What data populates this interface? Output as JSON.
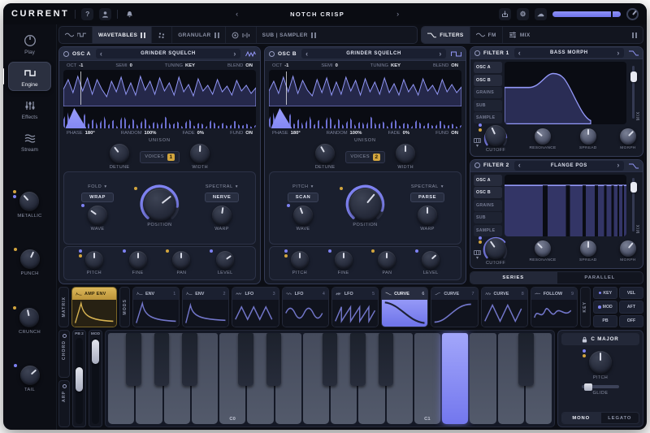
{
  "colors": {
    "accent": "#7b7ff0",
    "gold": "#d2a53e"
  },
  "icons": {
    "chevron_left": "‹",
    "chevron_right": "›",
    "help": "?",
    "gear": "⚙",
    "cloud": "☁",
    "dropdown": "▾"
  },
  "topbar": {
    "logo": "CURRENT",
    "preset": "NOTCH CRISP"
  },
  "sidebar": {
    "nav": [
      {
        "label": "Play"
      },
      {
        "label": "Engine"
      },
      {
        "label": "Effects"
      },
      {
        "label": "Stream"
      }
    ],
    "macros": [
      {
        "label": "METALLIC"
      },
      {
        "label": "PUNCH"
      },
      {
        "label": "CRUNCH"
      },
      {
        "label": "TAIL"
      }
    ]
  },
  "tabs": {
    "wavetables": "WAVETABLES",
    "granular": "GRANULAR",
    "sub_sampler": "SUB | SAMPLER",
    "filters": "FILTERS",
    "fm": "FM",
    "mix": "MIX"
  },
  "osc_a": {
    "title": "OSC A",
    "preset": "GRINDER SQUELCH",
    "top_params": [
      [
        "OCT",
        "-1"
      ],
      [
        "SEMI",
        "0"
      ],
      [
        "TUNING",
        "KEY"
      ],
      [
        "BLEND",
        "ON"
      ]
    ],
    "wave_params": [
      [
        "PHASE",
        "180°"
      ],
      [
        "RANDOM",
        "100%"
      ],
      [
        "FADE",
        "0%"
      ],
      [
        "FUND",
        "ON"
      ]
    ],
    "unison_label": "UNISON",
    "detune": "DETUNE",
    "voices_label": "VOICES",
    "voices": "1",
    "width": "WIDTH",
    "mode_header": "FOLD",
    "mode": "WRAP",
    "spectral_header": "SPECTRAL",
    "spectral": "NERVE",
    "wave": "WAVE",
    "position": "POSITION",
    "warp": "WARP",
    "mixer": [
      "PITCH",
      "FINE",
      "PAN",
      "LEVEL"
    ]
  },
  "osc_b": {
    "title": "OSC B",
    "preset": "GRINDER SQUELCH",
    "top_params": [
      [
        "OCT",
        "-1"
      ],
      [
        "SEMI",
        "0"
      ],
      [
        "TUNING",
        "KEY"
      ],
      [
        "BLEND",
        "ON"
      ]
    ],
    "wave_params": [
      [
        "PHASE",
        "180°"
      ],
      [
        "RANDOM",
        "100%"
      ],
      [
        "FADE",
        "0%"
      ],
      [
        "FUND",
        "ON"
      ]
    ],
    "unison_label": "UNISON",
    "detune": "DETUNE",
    "voices_label": "VOICES",
    "voices": "2",
    "width": "WIDTH",
    "mode_header": "PITCH",
    "mode": "SCAN",
    "spectral_header": "SPECTRAL",
    "spectral": "PARSE",
    "wave": "WAVE",
    "position": "POSITION",
    "warp": "WARP",
    "mixer": [
      "PITCH",
      "FINE",
      "PAN",
      "LEVEL"
    ]
  },
  "filter1": {
    "title": "FILTER 1",
    "preset": "BASS MORPH",
    "sources": [
      "OSC A",
      "OSC B",
      "GRAINS",
      "SUB",
      "SAMPLE"
    ],
    "mix": "MIX",
    "knobs": [
      "CUTOFF",
      "RESONANCE",
      "SPREAD",
      "MORPH"
    ]
  },
  "filter2": {
    "title": "FILTER 2",
    "preset": "FLANGE POS",
    "sources": [
      "OSC A",
      "OSC B",
      "GRAINS",
      "SUB",
      "SAMPLE"
    ],
    "mix": "MIX",
    "knobs": [
      "CUTOFF",
      "RESONANCE",
      "SPREAD",
      "MORPH"
    ]
  },
  "routing": {
    "series": "SERIES",
    "parallel": "PARALLEL"
  },
  "mods": {
    "matrix": "MATRIX",
    "amp_env": "AMP ENV",
    "mods_label": "MODS",
    "key_label": "KEY",
    "slots": [
      {
        "name": "ENV",
        "num": "1"
      },
      {
        "name": "ENV",
        "num": "2"
      },
      {
        "name": "LFO",
        "num": "3"
      },
      {
        "name": "LFO",
        "num": "4"
      },
      {
        "name": "LFO",
        "num": "5"
      },
      {
        "name": "CURVE",
        "num": "6"
      },
      {
        "name": "CURVE",
        "num": "7"
      },
      {
        "name": "CURVE",
        "num": "8"
      },
      {
        "name": "FOLLOW",
        "num": "9"
      }
    ],
    "key_buttons": [
      "KEY",
      "VEL",
      "MOD",
      "AFT",
      "PB",
      "OFF"
    ]
  },
  "kb": {
    "chord": "CHORD",
    "arp": "ARP",
    "pb": "PB 2",
    "mod": "MOD",
    "note_labels": [
      "C0",
      "C1"
    ],
    "scale": "C MAJOR",
    "pitch": "PITCH",
    "glide": "GLIDE",
    "mono": "MONO",
    "legato": "LEGATO"
  }
}
